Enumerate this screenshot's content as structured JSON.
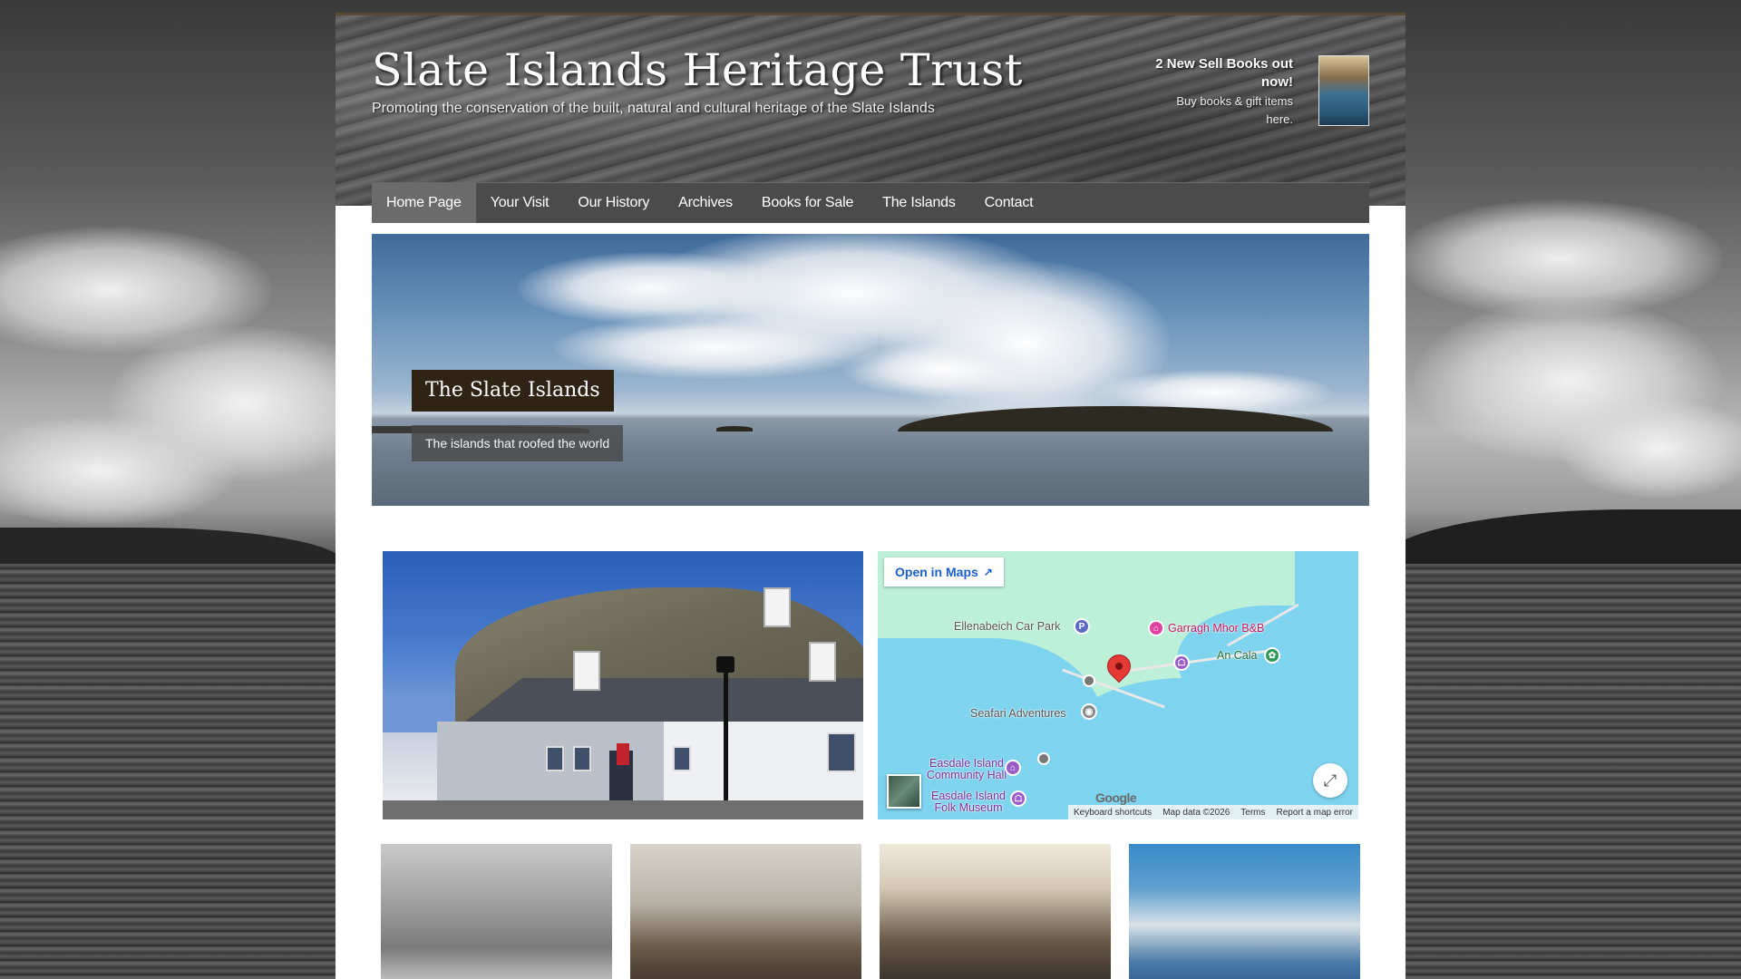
{
  "site": {
    "title": "Slate Islands Heritage Trust",
    "tagline": "Promoting the conservation of the built, natural and cultural heritage of the Slate Islands"
  },
  "promo": {
    "heading": "2 New Sell Books out now!",
    "subtext": "Buy books & gift items here."
  },
  "nav": {
    "items": [
      {
        "label": "Home Page",
        "active": true
      },
      {
        "label": "Your Visit",
        "active": false
      },
      {
        "label": "Our History",
        "active": false
      },
      {
        "label": "Archives",
        "active": false
      },
      {
        "label": "Books for Sale",
        "active": false
      },
      {
        "label": "The Islands",
        "active": false
      },
      {
        "label": "Contact",
        "active": false
      }
    ]
  },
  "hero": {
    "title": "The Slate Islands",
    "subtitle": "The islands that roofed the world"
  },
  "map": {
    "open_button": "Open in Maps",
    "labels": {
      "car_park": "Ellenabeich Car Park",
      "bnb": "Garragh Mhor B&B",
      "an_cala": "An Cala",
      "seafari": "Seafari Adventures",
      "community_hall": "Easdale Island Community Hall",
      "folk_museum": "Easdale Island Folk Museum"
    },
    "logo": "Google",
    "footer": {
      "shortcuts": "Keyboard shortcuts",
      "map_data": "Map data ©2026",
      "terms": "Terms",
      "report": "Report a map error"
    },
    "parking_glyph": "P"
  },
  "colors": {
    "nav_bg": "#4b4b4b",
    "nav_active": "#6b6b6b",
    "hero_title_bg": "#2f2414",
    "map_link": "#1a5fd0",
    "pin": "#e53935"
  }
}
